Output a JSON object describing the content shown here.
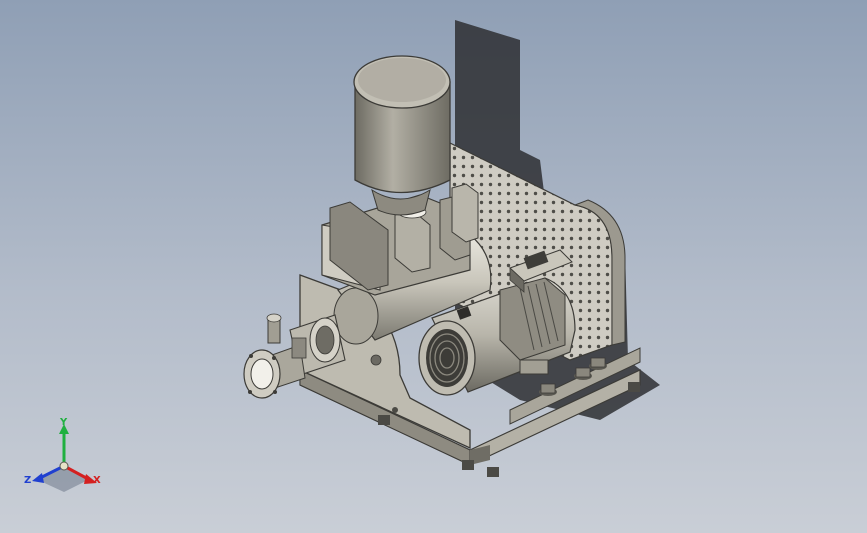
{
  "viewport": {
    "background_top": "#8f9fb5",
    "background_bottom": "#c9ced6",
    "model": "blower-skid-assembly"
  },
  "triad": {
    "x_label": "X",
    "y_label": "Y",
    "z_label": "Z",
    "x_color": "#d42020",
    "y_color": "#20b040",
    "z_color": "#2040d0"
  }
}
